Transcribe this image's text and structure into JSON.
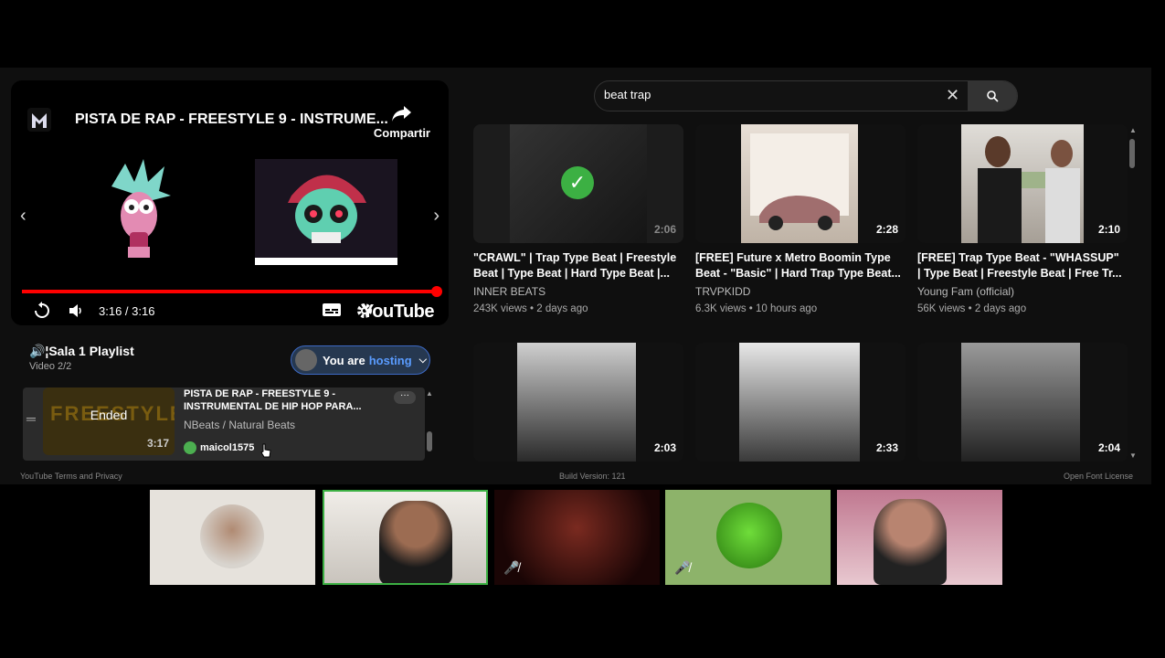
{
  "player": {
    "title": "PISTA DE RAP - FREESTYLE 9 - INSTRUME...",
    "share_label": "Compartir",
    "time": "3:16 / 3:16",
    "progress": 1.0,
    "logo_text": "YouTube"
  },
  "playlist": {
    "title": "🔊¦Sala 1 Playlist",
    "subtitle": "Video 2/2",
    "host": {
      "prefix": "You are",
      "highlight": "hosting"
    },
    "item": {
      "status": "Ended",
      "thumb_text": "FREESTYLE",
      "duration": "3:17",
      "title": "PISTA DE RAP - FREESTYLE 9 - INSTRUMENTAL DE HIP HOP PARA...",
      "channel": "NBeats / Natural Beats",
      "added_by": "maicol1575",
      "more": "···"
    }
  },
  "search": {
    "value": "beat trap"
  },
  "results": [
    {
      "title": "\"CRAWL\" | Trap Type Beat | Freestyle Beat | Type Beat | Hard Type Beat |...",
      "channel": "INNER BEATS",
      "meta": "243K views • 2 days ago",
      "duration": "2:06",
      "watched": true
    },
    {
      "title": "[FREE] Future x Metro Boomin Type Beat - \"Basic\" | Hard Trap Type Beat...",
      "channel": "TRVPKIDD",
      "meta": "6.3K views • 10 hours ago",
      "duration": "2:28"
    },
    {
      "title": "[FREE] Trap Type Beat - \"WHASSUP\" | Type Beat | Freestyle Beat | Free Tr...",
      "channel": "Young Fam (official)",
      "meta": "56K views • 2 days ago",
      "duration": "2:10"
    },
    {
      "duration": "2:03"
    },
    {
      "duration": "2:33"
    },
    {
      "duration": "2:04"
    }
  ],
  "footer": {
    "left": "YouTube Terms and Privacy",
    "center": "Build Version: 121",
    "right": "Open Font License"
  },
  "colors": {
    "accent": "#3cb043",
    "progress": "#ff0000",
    "host_blue": "#5a9cff"
  }
}
